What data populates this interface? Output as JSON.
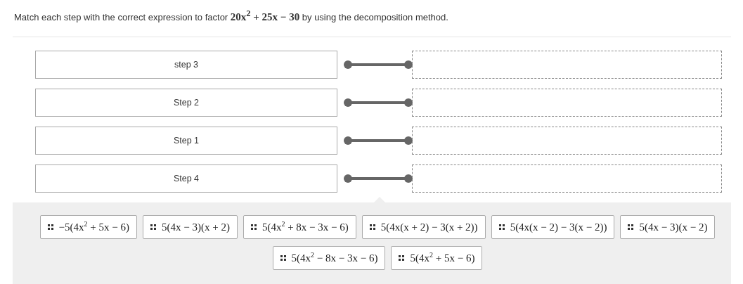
{
  "question": "Match each step with the correct expression to factor **20x$^{2}$ + 25x − 30** by using the decomposition method.",
  "rows": [
    {
      "label": "step 3"
    },
    {
      "label": "Step 2"
    },
    {
      "label": "Step 1"
    },
    {
      "label": "Step 4"
    }
  ],
  "options": [
    {
      "text": "−5(4x$^{2}$ + 5x − 6)"
    },
    {
      "text": "5(4x − 3)(x + 2)"
    },
    {
      "text": "5(4x$^{2}$ + 8x − 3x − 6)"
    },
    {
      "text": "5(4x(x + 2) − 3(x + 2))"
    },
    {
      "text": "5(4x(x − 2) − 3(x − 2))"
    },
    {
      "text": "5(4x − 3)(x − 2)"
    },
    {
      "text": "5(4x$^{2}$ − 8x − 3x − 6)"
    },
    {
      "text": "5(4x$^{2}$ + 5x − 6)"
    }
  ]
}
